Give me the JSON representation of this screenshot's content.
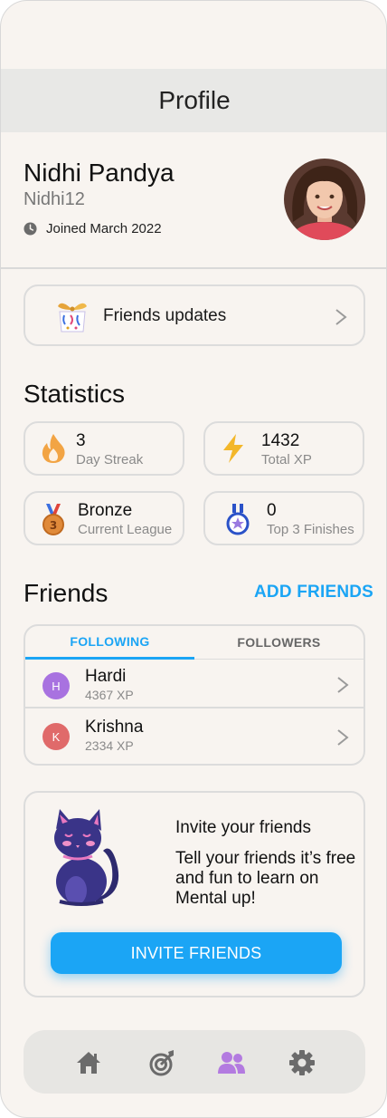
{
  "header": {
    "title": "Profile"
  },
  "profile": {
    "name": "Nidhi Pandya",
    "username": "Nidhi12",
    "joined": "Joined March 2022"
  },
  "updates": {
    "label": "Friends updates"
  },
  "statistics": {
    "title": "Statistics",
    "items": [
      {
        "value": "3",
        "label": "Day Streak",
        "icon": "flame-icon"
      },
      {
        "value": "1432",
        "label": "Total XP",
        "icon": "lightning-icon"
      },
      {
        "value": "Bronze",
        "label": "Current League",
        "icon": "bronze-medal-icon"
      },
      {
        "value": "0",
        "label": "Top 3 Finishes",
        "icon": "star-medal-icon"
      }
    ]
  },
  "friends": {
    "title": "Friends",
    "add_label": "ADD FRIENDS",
    "tabs": [
      {
        "label": "FOLLOWING",
        "active": true
      },
      {
        "label": "FOLLOWERS",
        "active": false
      }
    ],
    "list": [
      {
        "initial": "H",
        "name": "Hardi",
        "xp": "4367 XP",
        "color": "#a872e0"
      },
      {
        "initial": "K",
        "name": "Krishna",
        "xp": "2334 XP",
        "color": "#e06a6a"
      }
    ]
  },
  "invite": {
    "title": "Invite your friends",
    "text": "Tell your friends it’s free and fun to learn on Mental up!",
    "button": "INVITE FRIENDS"
  },
  "nav": {
    "items": [
      {
        "icon": "home-icon",
        "active": false
      },
      {
        "icon": "target-icon",
        "active": false
      },
      {
        "icon": "friends-icon",
        "active": true
      },
      {
        "icon": "gear-icon",
        "active": false
      }
    ]
  },
  "colors": {
    "accent": "#1ba5f5",
    "background": "#f8f4f0",
    "active_nav": "#b37be0",
    "inactive_nav": "#6b6b6b"
  }
}
